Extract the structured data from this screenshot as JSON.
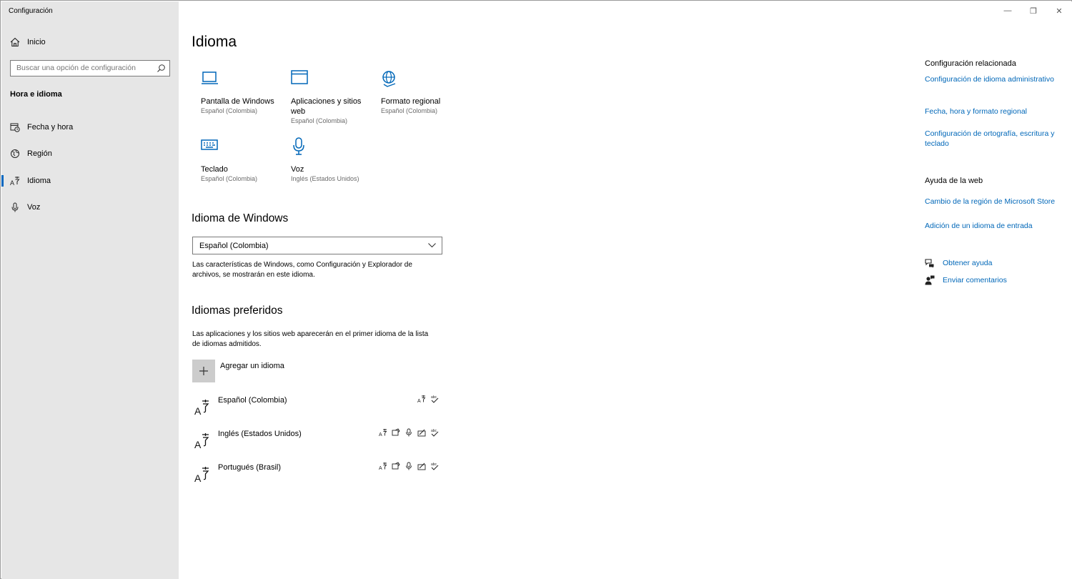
{
  "window": {
    "title": "Configuración",
    "controls": {
      "minimize": "—",
      "restore": "❐",
      "close": "✕"
    }
  },
  "sidebar": {
    "home_label": "Inicio",
    "search_placeholder": "Buscar una opción de configuración",
    "group_header": "Hora e idioma",
    "items": [
      {
        "label": "Fecha y hora",
        "icon": "calendar-clock-icon"
      },
      {
        "label": "Región",
        "icon": "globe-region-icon"
      },
      {
        "label": "Idioma",
        "icon": "language-icon",
        "active": true
      },
      {
        "label": "Voz",
        "icon": "microphone-icon"
      }
    ]
  },
  "main": {
    "title": "Idioma",
    "tiles": [
      {
        "name": "Pantalla de Windows",
        "sub": "Español (Colombia)",
        "icon": "laptop-icon"
      },
      {
        "name": "Aplicaciones y sitios web",
        "sub": "Español (Colombia)",
        "icon": "window-icon"
      },
      {
        "name": "Formato regional",
        "sub": "Español (Colombia)",
        "icon": "globe-icon"
      },
      {
        "name": "Teclado",
        "sub": "Español (Colombia)",
        "icon": "keyboard-icon"
      },
      {
        "name": "Voz",
        "sub": "Inglés (Estados Unidos)",
        "icon": "microphone-icon"
      }
    ],
    "windows_language": {
      "heading": "Idioma de Windows",
      "selected": "Español (Colombia)",
      "description": "Las características de Windows, como Configuración y Explorador de archivos, se mostrarán en este idioma."
    },
    "preferred": {
      "heading": "Idiomas preferidos",
      "description": "Las aplicaciones y los sitios web aparecerán en el primer idioma de la lista de idiomas admitidos.",
      "add_label": "Agregar un idioma",
      "languages": [
        {
          "name": "Español (Colombia)",
          "features": [
            "display-language-icon",
            "spellcheck-icon"
          ]
        },
        {
          "name": "Inglés (Estados Unidos)",
          "features": [
            "display-language-icon",
            "text-to-speech-icon",
            "speech-recognition-icon",
            "handwriting-icon",
            "spellcheck-icon"
          ]
        },
        {
          "name": "Portugués (Brasil)",
          "features": [
            "display-language-icon",
            "text-to-speech-icon",
            "speech-recognition-icon",
            "handwriting-icon",
            "spellcheck-icon"
          ]
        }
      ]
    }
  },
  "related": {
    "heading": "Configuración relacionada",
    "links": [
      "Configuración de idioma administrativo",
      "Fecha, hora y formato regional",
      "Configuración de ortografía, escritura y teclado"
    ],
    "web_help_heading": "Ayuda de la web",
    "web_links": [
      "Cambio de la región de Microsoft Store",
      "Adición de un idioma de entrada"
    ],
    "get_help": "Obtener ayuda",
    "feedback": "Enviar comentarios"
  },
  "colors": {
    "accent": "#0067b8",
    "sidebar_bg": "#e6e6e6",
    "active_bar": "#0067c0"
  }
}
